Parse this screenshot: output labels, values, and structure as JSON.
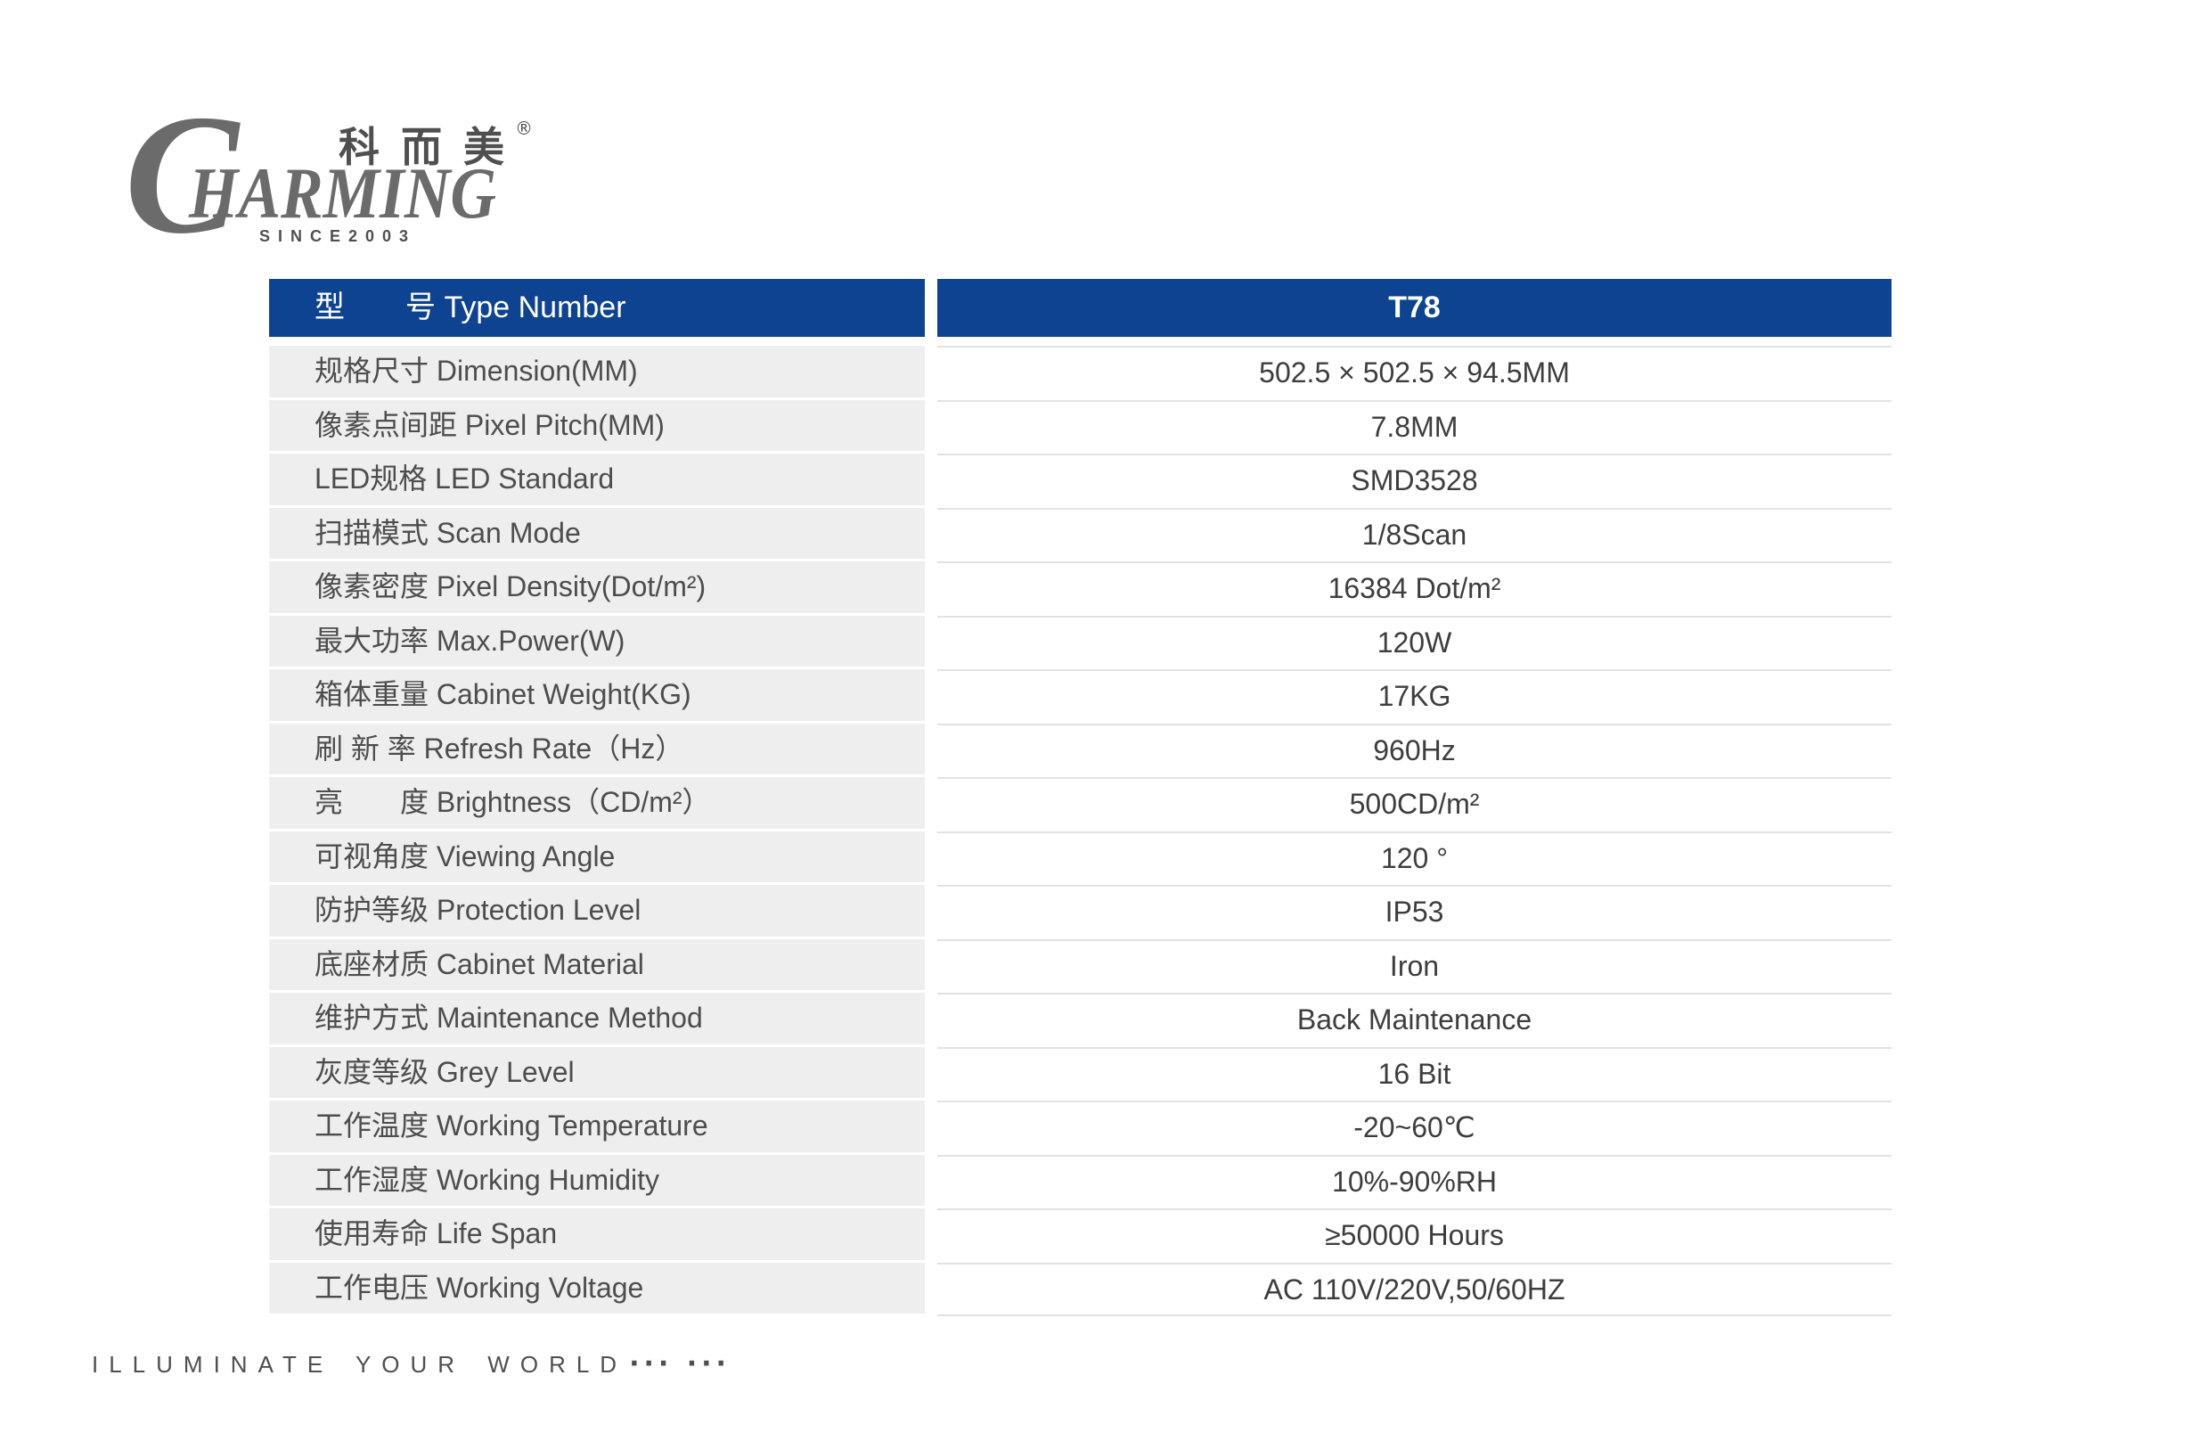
{
  "logo": {
    "initial": "C",
    "name_rest": "HARMING",
    "chinese_name": "科 而 美",
    "registered_mark": "®",
    "since": "SINCE2003",
    "color": "#6b6b6b"
  },
  "table": {
    "header": {
      "label": "型　　号 Type Number",
      "model": "T78",
      "color": "#0d4391"
    },
    "rows": [
      {
        "label": "规格尺寸 Dimension(MM)",
        "value": "502.5 × 502.5 × 94.5MM"
      },
      {
        "label": "像素点间距 Pixel Pitch(MM)",
        "value": "7.8MM"
      },
      {
        "label": "LED规格 LED Standard",
        "value": "SMD3528"
      },
      {
        "label": "扫描模式 Scan Mode",
        "value": "1/8Scan"
      },
      {
        "label": "像素密度 Pixel Density(Dot/m²)",
        "value": "16384 Dot/m²"
      },
      {
        "label": "最大功率 Max.Power(W)",
        "value": "120W"
      },
      {
        "label": "箱体重量 Cabinet Weight(KG)",
        "value": "17KG"
      },
      {
        "label": "刷 新 率 Refresh Rate（Hz）",
        "value": "960Hz"
      },
      {
        "label": "亮　　度 Brightness（CD/m²）",
        "value": "500CD/m²"
      },
      {
        "label": "可视角度 Viewing Angle",
        "value": "120 °"
      },
      {
        "label": "防护等级 Protection Level",
        "value": "IP53"
      },
      {
        "label": "底座材质 Cabinet Material",
        "value": "Iron"
      },
      {
        "label": "维护方式 Maintenance Method",
        "value": "Back Maintenance"
      },
      {
        "label": "灰度等级 Grey Level",
        "value": "16 Bit"
      },
      {
        "label": "工作温度 Working Temperature",
        "value": "-20~60℃"
      },
      {
        "label": "工作湿度 Working Humidity",
        "value": "10%-90%RH"
      },
      {
        "label": "使用寿命 Life Span",
        "value": "≥50000 Hours"
      },
      {
        "label": "工作电压 Working Voltage",
        "value": "AC 110V/220V,50/60HZ"
      }
    ],
    "label_cell_color": "#eeeeee"
  },
  "footer": {
    "slogan": "ILLUMINATE YOUR WORLD",
    "dots": "··· ···"
  }
}
